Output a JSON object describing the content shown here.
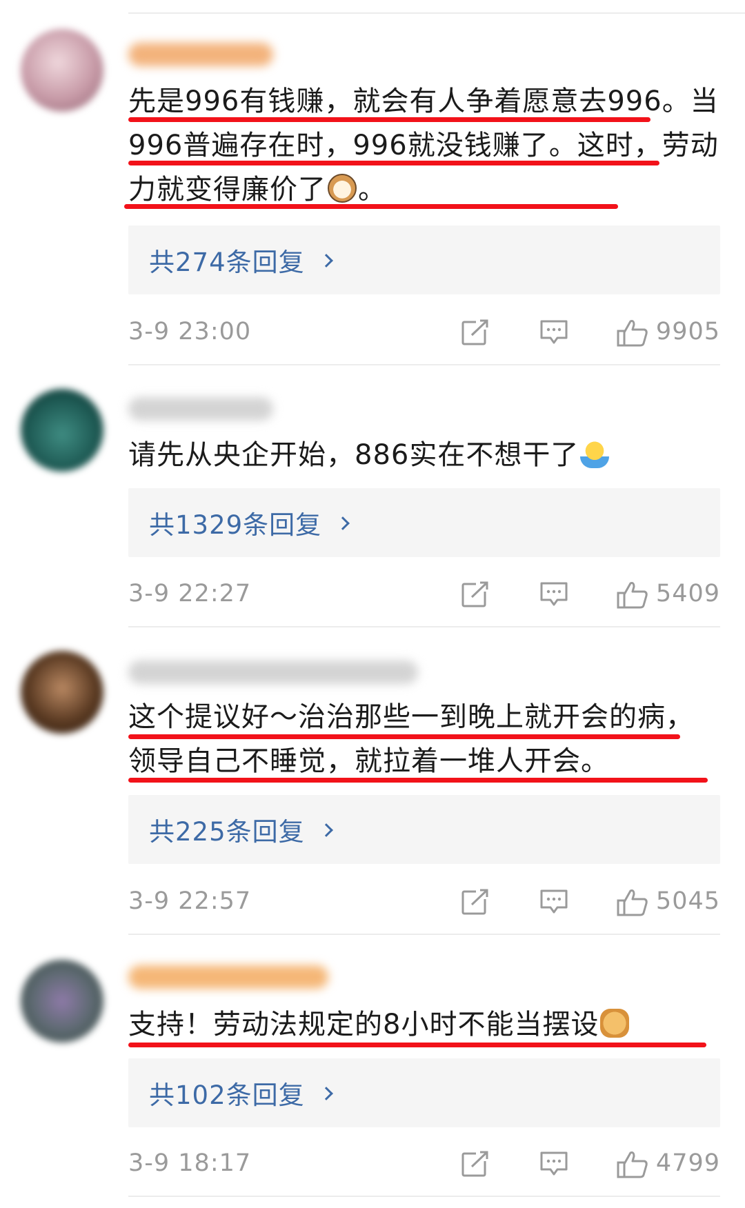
{
  "comments": [
    {
      "text_parts": [
        "先是996有钱赚，就会有人争着愿意去996。当996普遍存在时，996就没钱赚了。这时，劳动力就变得廉价了",
        "。"
      ],
      "emoji": "cat-face-emoji",
      "replies": "共274条回复",
      "time": "3-9 23:00",
      "likes": "9905",
      "avatar_color": "#c79aa7",
      "name_color": "#f3b37c"
    },
    {
      "text_parts": [
        "请先从央企开始，886实在不想干了",
        ""
      ],
      "emoji": "shrug-emoji",
      "replies": "共1329条回复",
      "time": "3-9 22:27",
      "likes": "5409",
      "avatar_color": "#1e5a54",
      "name_color": "#c9c9c9"
    },
    {
      "text_parts": [
        "这个提议好～治治那些一到晚上就开会的病，领导自己不睡觉，就拉着一堆人开会。",
        ""
      ],
      "emoji": "",
      "replies": "共225条回复",
      "time": "3-9 22:57",
      "likes": "5045",
      "avatar_color": "#5a3a22",
      "name_color": "#c9c9c9"
    },
    {
      "text_parts": [
        "支持！劳动法规定的8小时不能当摆设",
        ""
      ],
      "emoji": "fist-emoji",
      "replies": "共102条回复",
      "time": "3-9 18:17",
      "likes": "4799",
      "avatar_color": "#5e6a72",
      "name_color": "#f5b777"
    }
  ],
  "icons": {
    "share": "share-icon",
    "comment": "comment-icon",
    "like": "thumbs-up-icon"
  },
  "colors": {
    "underline": "#f2121a",
    "reply_link": "#3d6aa6",
    "meta": "#9a9a9a"
  }
}
